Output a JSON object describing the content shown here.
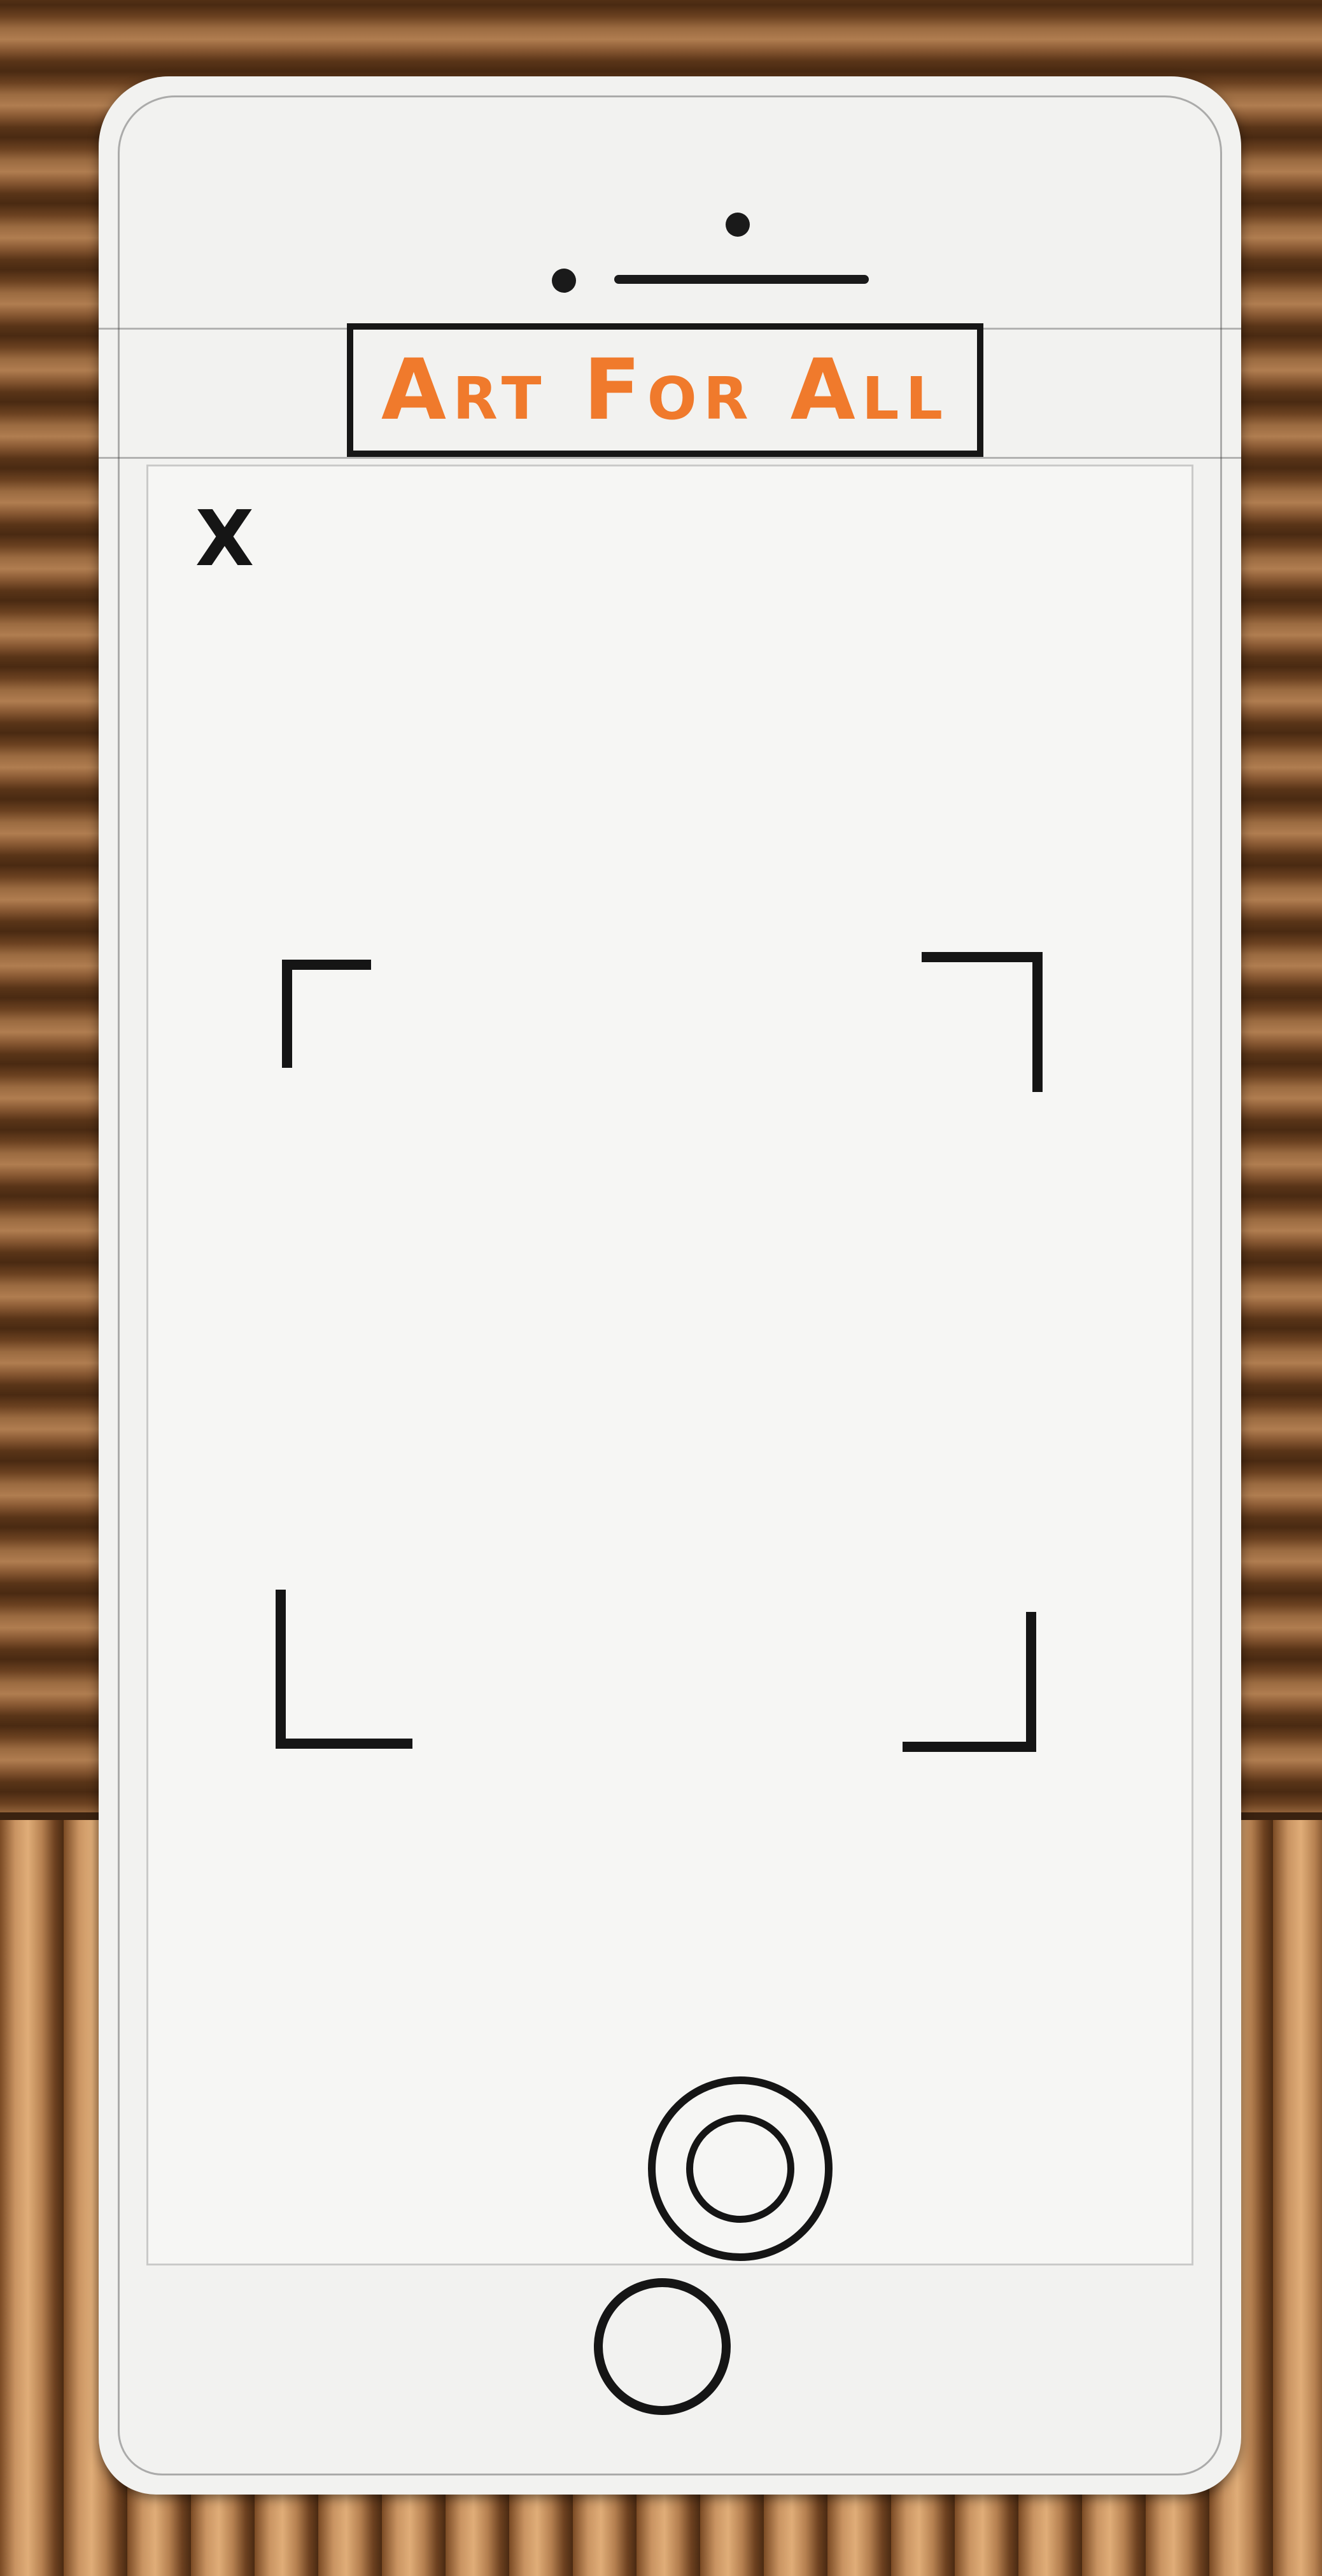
{
  "app": {
    "title": "Art For All"
  },
  "camera_view": {
    "close_label": "X"
  },
  "colors": {
    "title_text": "#f07a2c",
    "ink": "#151515",
    "paper": "#f2f2f0"
  },
  "icons": {
    "close": "close-icon",
    "shutter": "shutter-button-icon",
    "home": "home-button-icon"
  }
}
